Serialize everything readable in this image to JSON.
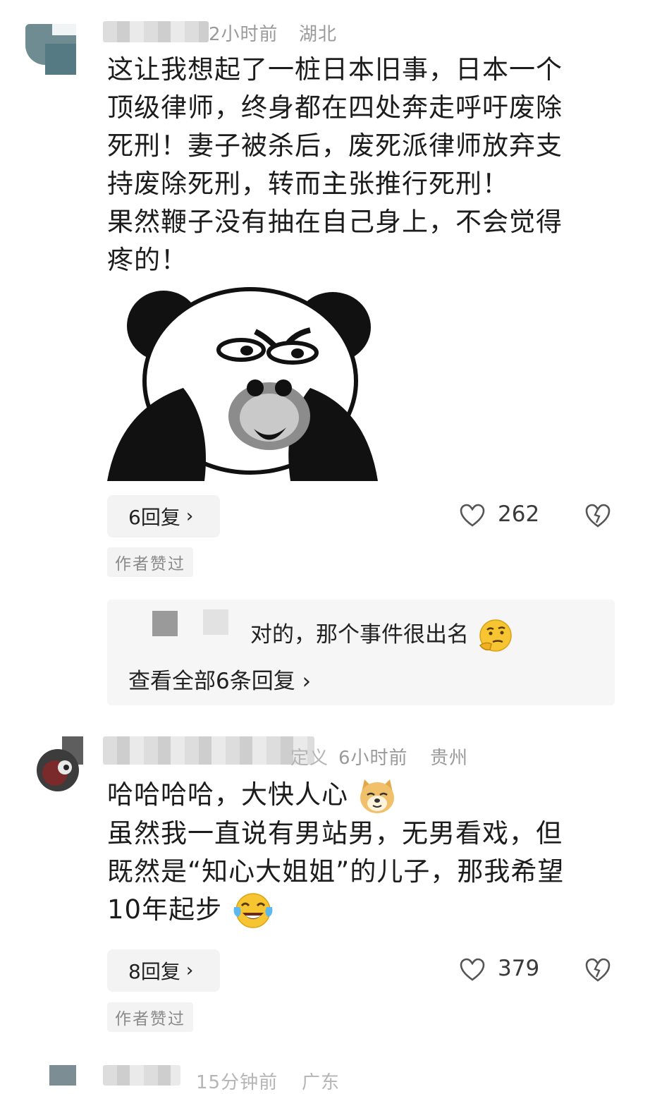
{
  "comments": [
    {
      "time": "2小时前",
      "location": "湖北",
      "lines": [
        "这让我想起了一桩日本旧事，日本一个",
        "顶级律师，终身都在四处奔走呼吁废除",
        "死刑！妻子被杀后，废死派律师放弃支",
        "持废除死刑，转而主张推行死刑！",
        "果然鞭子没有抽在自己身上，不会觉得",
        "疼的！"
      ],
      "replies_label": "6回复",
      "likes": "262",
      "author_badge": "作者赞过",
      "reply_preview": "对的，那个事件很出名",
      "view_all": "查看全部6条回复"
    },
    {
      "name_tail": "定义",
      "time": "6小时前",
      "location": "贵州",
      "line1": "哈哈哈哈，大快人心",
      "line2": "虽然我一直说有男站男，无男看戏，但",
      "line3": "既然是“知心大姐姐”的儿子，那我希望",
      "line4": "10年起步",
      "replies_label": "8回复",
      "likes": "379",
      "author_badge": "作者赞过"
    },
    {
      "time": "15分钟前",
      "location": "广东"
    }
  ],
  "icons": {
    "like": "heart-outline-icon",
    "dislike": "broken-heart-icon",
    "chevron": "chevron-right-icon"
  },
  "colors": {
    "text": "#1c1c1c",
    "meta": "#9a9a9a",
    "pill_bg": "#f3f3f3"
  }
}
